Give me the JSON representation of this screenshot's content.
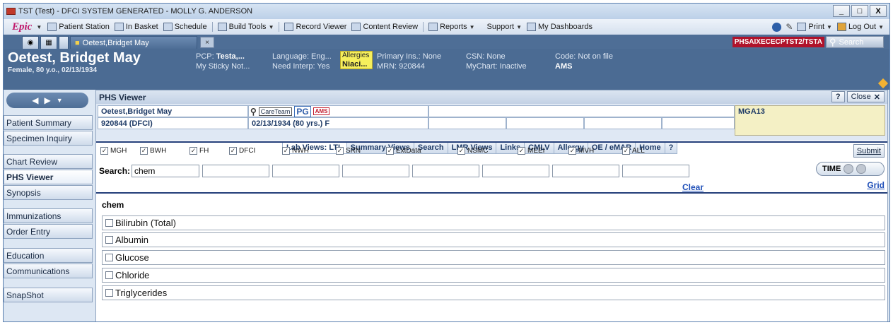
{
  "window": {
    "title": "TST (Test) - DFCI SYSTEM GENERATED - MOLLY G. ANDERSON",
    "buttons": {
      "minimize": "_",
      "maximize": "□",
      "close": "X"
    }
  },
  "menu": {
    "logo": "Epic",
    "items": [
      {
        "label": "Patient Station",
        "icon": "patient-station-icon"
      },
      {
        "label": "In Basket",
        "icon": "inbox-icon"
      },
      {
        "label": "Schedule",
        "icon": "schedule-icon"
      },
      {
        "label": "Build Tools",
        "icon": "build-tools-icon"
      },
      {
        "label": "Record Viewer",
        "icon": "record-viewer-icon"
      },
      {
        "label": "Content Review",
        "icon": "content-review-icon"
      },
      {
        "label": "Reports",
        "icon": "reports-icon"
      },
      {
        "label": "Support",
        "icon": ""
      },
      {
        "label": "My Dashboards",
        "icon": "dashboard-icon"
      }
    ],
    "right": {
      "print": "Print",
      "logout": "Log Out"
    }
  },
  "tabs": {
    "patient_tab": "Oetest,Bridget May",
    "close": "×",
    "env_badge": "PHSAIXECECPTST2/TSTA",
    "search_placeholder": "Search"
  },
  "patient": {
    "name": "Oetest, Bridget May",
    "sub": "Female, 80 y.o., 02/13/1934",
    "pcp_label": "PCP:",
    "pcp": "Testa,...",
    "sticky": "My Sticky Not...",
    "language": "Language: Eng...",
    "interp": "Need Interp: Yes",
    "allergies_label": "Allergies",
    "allergies_value": "Niaci...",
    "primary_ins": "Primary Ins.: None",
    "mrn": "MRN: 920844",
    "csn": "CSN: None",
    "mychart": "MyChart: Inactive",
    "code": "Code: Not on file",
    "ams": "AMS"
  },
  "nav": {
    "items": [
      "Patient Summary",
      "Specimen Inquiry",
      "Chart Review",
      "PHS Viewer",
      "Synopsis",
      "Immunizations",
      "Order Entry",
      "Education",
      "Communications",
      "SnapShot"
    ],
    "active": "PHS Viewer"
  },
  "phs": {
    "title": "PHS Viewer",
    "help": "?",
    "close": "Close",
    "close_x": "✕",
    "patient_name": "Oetest,Bridget May",
    "mrn_dfci": "920844 (DFCI)",
    "dob": "02/13/1934 (80 yrs.) F",
    "careteam": "CareTeam",
    "pg": "PG",
    "ams": "AMS",
    "mga": "MGA13",
    "lab_tabs": [
      "Lab Views: LTL",
      "Summary Views",
      "Search",
      "LMR Views",
      "Links",
      "CMLV",
      "Allergy",
      "OE / eMAR",
      "Home",
      "?"
    ],
    "hospitals": [
      "MGH",
      "BWH",
      "FH",
      "DFCI",
      "NWH",
      "SRN",
      "ExtData",
      "NSMC",
      "MEEI",
      "MVH",
      "ALL"
    ],
    "submit": "Submit",
    "time": "TIME",
    "grid": "Grid",
    "search_label": "Search:",
    "search_value": "chem",
    "clear": "Clear",
    "section": "chem",
    "tests": [
      "Bilirubin (Total)",
      "Albumin",
      "Glucose",
      "Chloride",
      "Triglycerides"
    ]
  }
}
